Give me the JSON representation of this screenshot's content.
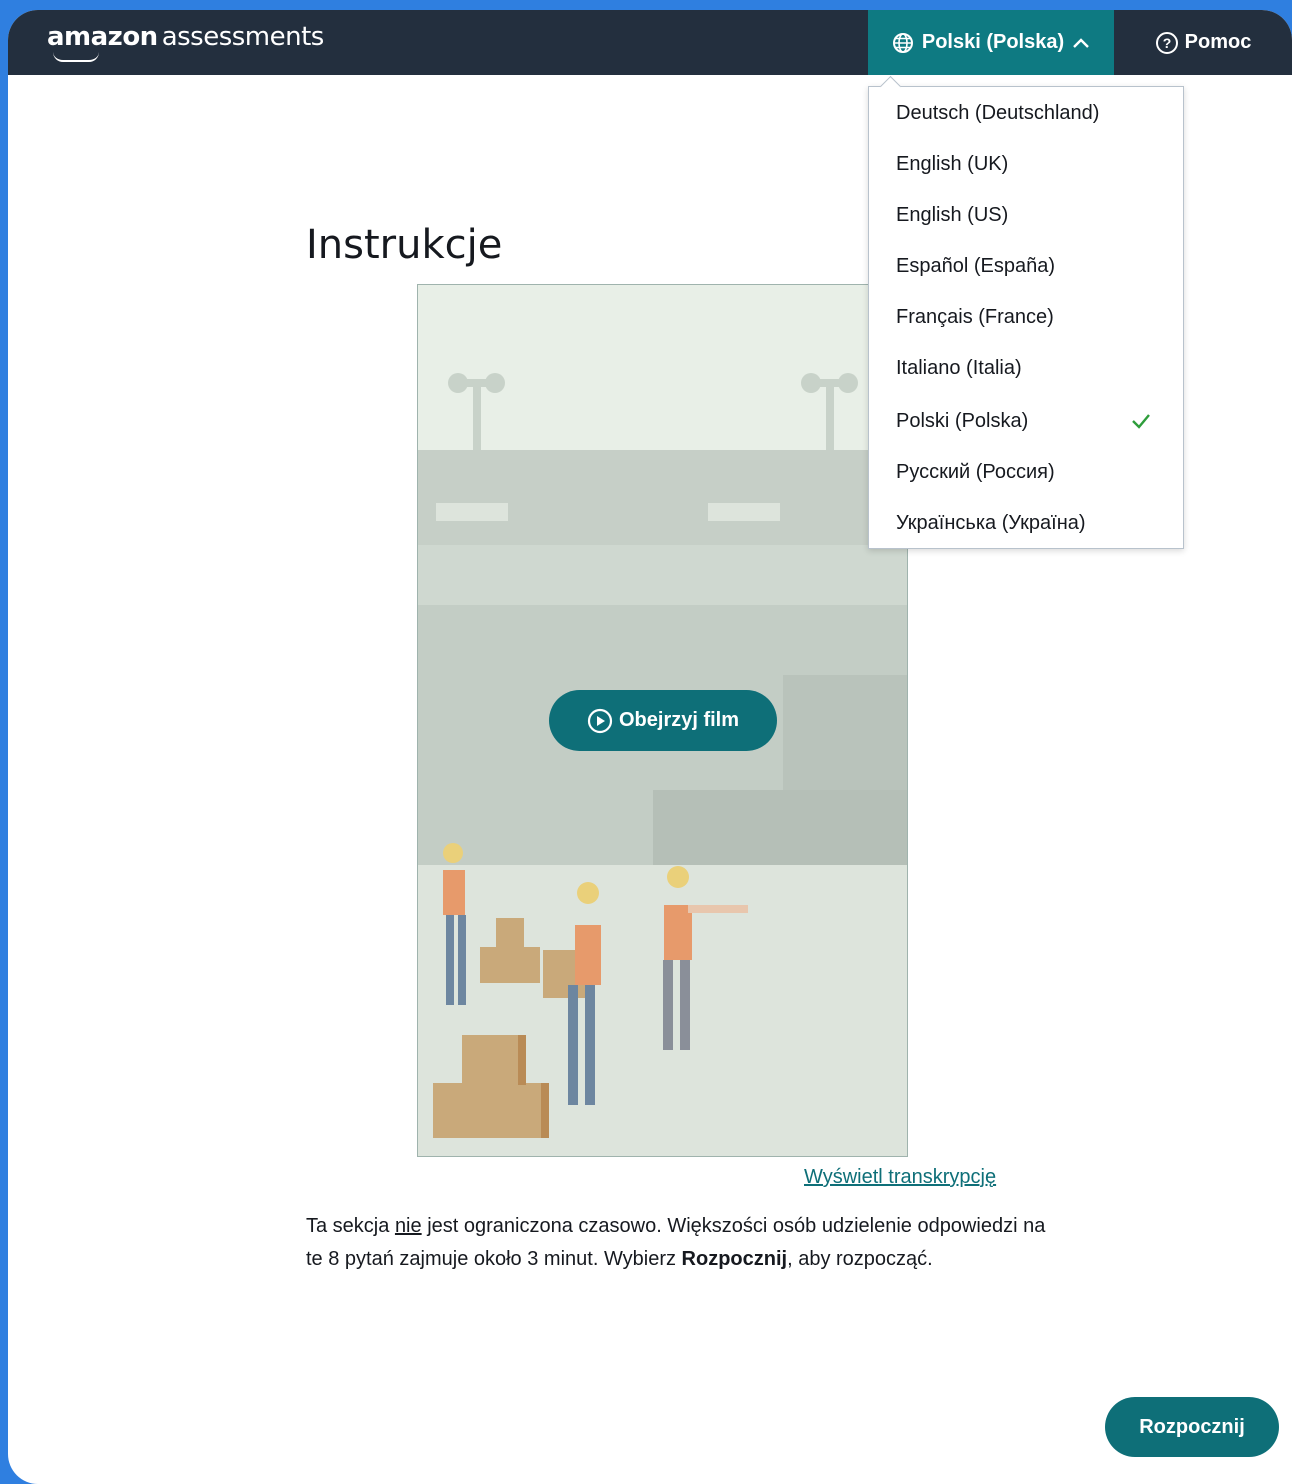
{
  "header": {
    "logo_brand": "amazon",
    "logo_product": "assessments",
    "language_button_label": "Polski (Polska)",
    "help_button_label": "Pomoc"
  },
  "language_menu": {
    "items": [
      {
        "label": "Deutsch (Deutschland)",
        "selected": false
      },
      {
        "label": "English (UK)",
        "selected": false
      },
      {
        "label": "English (US)",
        "selected": false
      },
      {
        "label": "Español (España)",
        "selected": false
      },
      {
        "label": "Français (France)",
        "selected": false
      },
      {
        "label": "Italiano (Italia)",
        "selected": false
      },
      {
        "label": "Polski (Polska)",
        "selected": true
      },
      {
        "label": "Русский (Россия)",
        "selected": false
      },
      {
        "label": "Українська (Україна)",
        "selected": false
      }
    ]
  },
  "main": {
    "title": "Instrukcje",
    "video_button_label": "Obejrzyj film",
    "transcript_link": "Wyświetl transkrypcję",
    "instructions": {
      "part1": "Ta sekcja ",
      "emphasis": "nie",
      "part2": " jest ograniczona czasowo. Większości osób udzielenie odpowiedzi na te 8 pytań zajmuje około 3 minut. Wybierz ",
      "bold": "Rozpocznij",
      "part3": ", aby rozpocząć."
    },
    "start_button_label": "Rozpocznij"
  },
  "colors": {
    "header_bg": "#232f3e",
    "accent": "#0e6f78",
    "check": "#2e9d3b",
    "outer_bg": "#2f7fe0"
  },
  "icons": [
    "globe-icon",
    "chevron-up-icon",
    "help-circle-icon",
    "check-icon",
    "play-circle-icon"
  ]
}
